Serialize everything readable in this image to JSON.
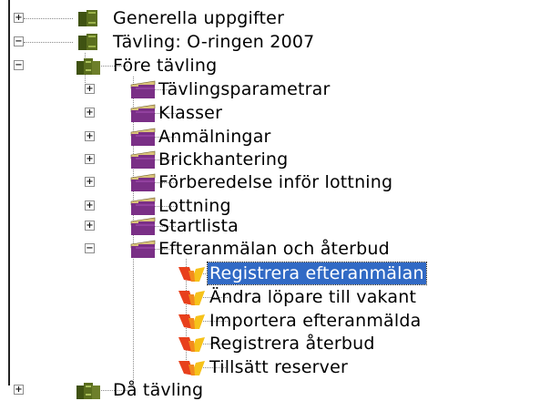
{
  "tree": {
    "nodes": [
      {
        "label": "Generella uppgifter",
        "level": 0,
        "toggle": "+",
        "icon": "book-icon"
      },
      {
        "label": "Tävling: O-ringen 2007",
        "level": 0,
        "toggle": "−",
        "icon": "book-icon"
      },
      {
        "label": "Före tävling",
        "level": 1,
        "toggle": "−",
        "icon": "books-icon"
      },
      {
        "label": "Tävlingsparametrar",
        "level": 2,
        "toggle": "+",
        "icon": "folder-icon"
      },
      {
        "label": "Klasser",
        "level": 2,
        "toggle": "+",
        "icon": "folder-icon"
      },
      {
        "label": "Anmälningar",
        "level": 2,
        "toggle": "+",
        "icon": "folder-icon"
      },
      {
        "label": "Brickhantering",
        "level": 2,
        "toggle": "+",
        "icon": "folder-icon"
      },
      {
        "label": "Förberedelse inför lottning",
        "level": 2,
        "toggle": "+",
        "icon": "folder-icon"
      },
      {
        "label": "Lottning",
        "level": 2,
        "toggle": "+",
        "icon": "folder-icon"
      },
      {
        "label": "Startlista",
        "level": 2,
        "toggle": "+",
        "icon": "folder-icon"
      },
      {
        "label": "Efteranmälan och återbud",
        "level": 2,
        "toggle": "−",
        "icon": "folder-open-icon"
      },
      {
        "label": "Registrera efteranmälan",
        "level": 3,
        "toggle": "",
        "icon": "action-icon",
        "selected": true
      },
      {
        "label": "Ändra löpare till vakant",
        "level": 3,
        "toggle": "",
        "icon": "action-icon"
      },
      {
        "label": "Importera efteranmälda",
        "level": 3,
        "toggle": "",
        "icon": "action-icon"
      },
      {
        "label": "Registrera återbud",
        "level": 3,
        "toggle": "",
        "icon": "action-icon"
      },
      {
        "label": "Tillsätt reserver",
        "level": 3,
        "toggle": "",
        "icon": "action-icon"
      },
      {
        "label": "Då tävling",
        "level": 1,
        "toggle": "+",
        "icon": "books-icon",
        "partial": true
      }
    ]
  },
  "colors": {
    "selection": "#316ac5",
    "folder": "#7a2f86",
    "folder_top": "#d9c27a",
    "book": "#5a6e1e",
    "action_red": "#e8401c",
    "action_yellow": "#f6c21a"
  }
}
